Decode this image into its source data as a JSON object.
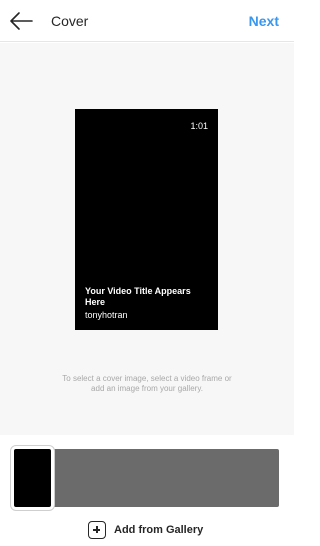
{
  "header": {
    "title": "Cover",
    "next_label": "Next"
  },
  "preview": {
    "duration": "1:01",
    "video_title": "Your Video Title Appears Here",
    "username": "tonyhotran"
  },
  "hint": "To select a cover image, select a video frame or add an image from your gallery.",
  "gallery": {
    "label": "Add from Gallery",
    "icon": "plus-square-icon"
  },
  "colors": {
    "accent": "#3897f0",
    "filmstrip": "#6b6b6b",
    "preview_bg": "#000000"
  }
}
